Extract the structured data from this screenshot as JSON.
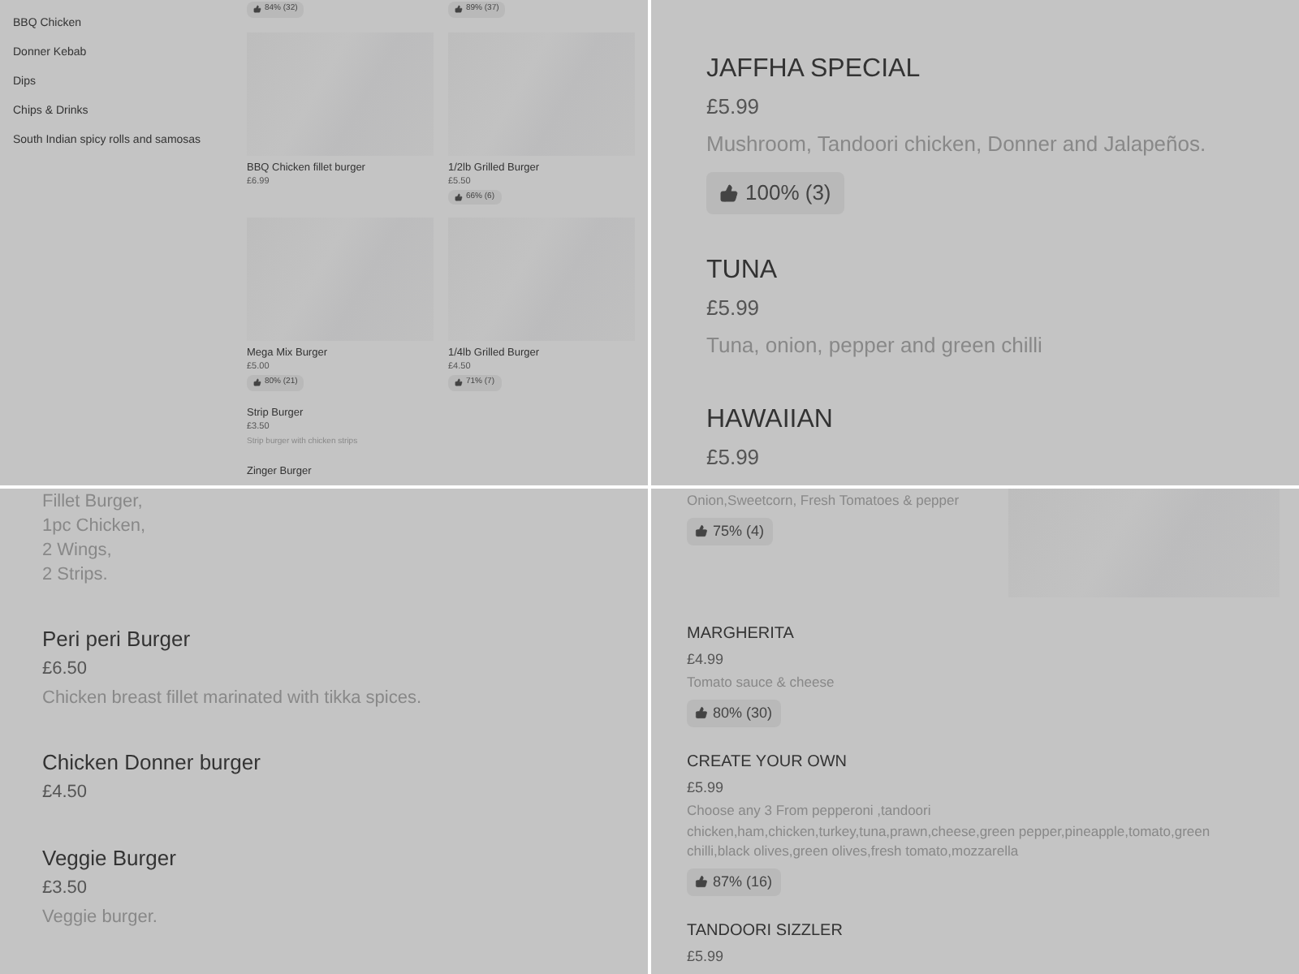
{
  "panels": [
    {
      "kind": "category_grid",
      "sidebar": {
        "items": [
          {
            "label": "BBQ Chicken"
          },
          {
            "label": "Donner Kebab"
          },
          {
            "label": "Dips"
          },
          {
            "label": "Chips & Drinks"
          },
          {
            "label": "South Indian spicy rolls and samosas"
          }
        ]
      },
      "top_ratings": [
        "84% (32)",
        "89% (37)"
      ],
      "grid": [
        {
          "name": "BBQ Chicken fillet burger",
          "price": "£6.99"
        },
        {
          "name": "1/2lb Grilled Burger",
          "price": "£5.50",
          "rating": "66% (6)"
        },
        {
          "name": "Mega Mix Burger",
          "price": "£5.00",
          "rating": "80% (21)"
        },
        {
          "name": "1/4lb Grilled Burger",
          "price": "£4.50",
          "rating": "71% (7)"
        }
      ],
      "list": [
        {
          "name": "Strip Burger",
          "price": "£3.50",
          "description": "Strip burger with chicken strips"
        },
        {
          "name": "Zinger Burger"
        }
      ]
    },
    {
      "kind": "menu_large",
      "items": [
        {
          "name": "JAFFHA SPECIAL",
          "price": "£5.99",
          "description": "Mushroom, Tandoori chicken, Donner and Jalapeños.",
          "rating": "100% (3)"
        },
        {
          "name": "TUNA",
          "price": "£5.99",
          "description": "Tuna, onion, pepper and green chilli"
        },
        {
          "name": "HAWAIIAN",
          "price": "£5.99"
        }
      ]
    },
    {
      "kind": "menu_medium",
      "lead_lines": [
        "Fillet Burger,",
        "1pc Chicken,",
        "2 Wings,",
        "2 Strips."
      ],
      "items": [
        {
          "name": "Peri peri Burger",
          "price": "£6.50",
          "description": "Chicken breast fillet marinated with tikka spices."
        },
        {
          "name": "Chicken Donner burger",
          "price": "£4.50"
        },
        {
          "name": "Veggie Burger",
          "price": "£3.50",
          "description": "Veggie burger."
        }
      ]
    },
    {
      "kind": "menu_small",
      "lead": {
        "description": "Onion,Sweetcorn, Fresh Tomatoes & pepper",
        "rating": "75% (4)"
      },
      "items": [
        {
          "name": "MARGHERITA",
          "price": "£4.99",
          "description": "Tomato sauce & cheese",
          "rating": "80% (30)"
        },
        {
          "name": "CREATE YOUR OWN",
          "price": "£5.99",
          "description": "Choose any 3 From pepperoni ,tandoori chicken,ham,chicken,turkey,tuna,prawn,cheese,green pepper,pineapple,tomato,green chilli,black olives,green olives,fresh tomato,mozzarella",
          "rating": "87% (16)"
        },
        {
          "name": "TANDOORI SIZZLER",
          "price": "£5.99"
        }
      ]
    }
  ]
}
